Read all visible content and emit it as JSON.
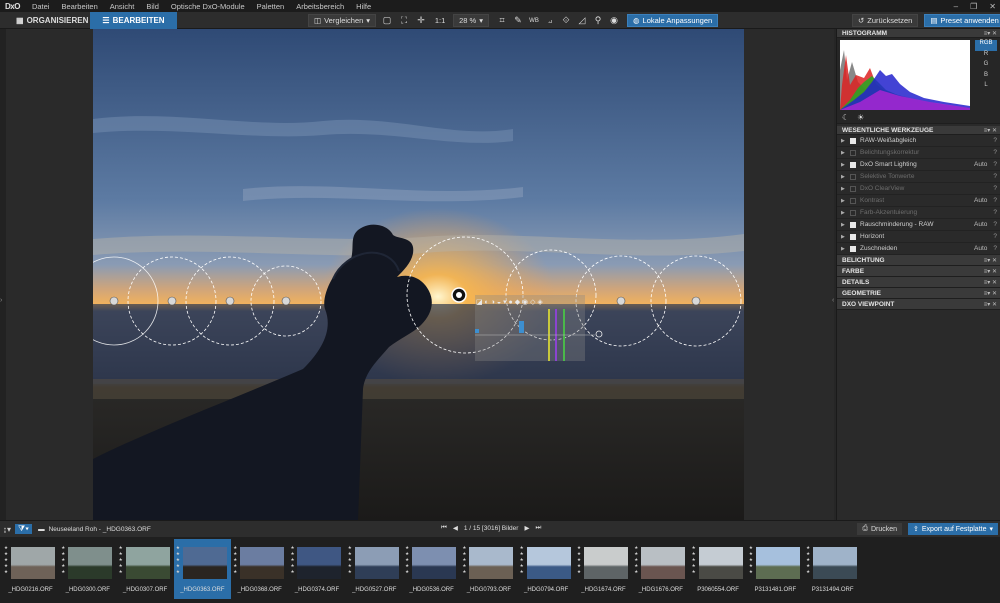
{
  "app": {
    "logo": "DxO"
  },
  "menu": [
    "Datei",
    "Bearbeiten",
    "Ansicht",
    "Bild",
    "Optische DxO-Module",
    "Paletten",
    "Arbeitsbereich",
    "Hilfe"
  ],
  "window_controls": [
    "–",
    "❐",
    "✕"
  ],
  "toolbar": {
    "tab_organize": "ORGANISIEREN",
    "tab_edit": "BEARBEITEN",
    "compare": "Vergleichen",
    "zoom_1to1": "1:1",
    "zoom_value": "28 %",
    "local_adjustments": "Lokale Anpassungen",
    "reset": "Zurücksetzen",
    "apply_preset": "Preset anwenden"
  },
  "histogram": {
    "title": "HISTOGRAMM",
    "channels": [
      "RGB",
      "R",
      "G",
      "B",
      "L"
    ],
    "selected_channel": "RGB"
  },
  "essential_tools": {
    "title": "WESENTLICHE WERKZEUGE",
    "items": [
      {
        "name": "RAW-Weißabgleich",
        "enabled": true,
        "auto": ""
      },
      {
        "name": "Belichtungskorrektur",
        "enabled": false,
        "auto": ""
      },
      {
        "name": "DxO Smart Lighting",
        "enabled": true,
        "auto": "Auto"
      },
      {
        "name": "Selektive Tonwerte",
        "enabled": false,
        "auto": ""
      },
      {
        "name": "DxO ClearView",
        "enabled": false,
        "auto": ""
      },
      {
        "name": "Kontrast",
        "enabled": false,
        "auto": "Auto"
      },
      {
        "name": "Farb-Akzentuierung",
        "enabled": false,
        "auto": ""
      },
      {
        "name": "Rauschminderung - RAW",
        "enabled": true,
        "auto": "Auto"
      },
      {
        "name": "Horizont",
        "enabled": true,
        "auto": ""
      },
      {
        "name": "Zuschneiden",
        "enabled": true,
        "auto": "Auto"
      }
    ]
  },
  "palettes": [
    "BELICHTUNG",
    "FARBE",
    "DETAILS",
    "GEOMETRIE",
    "DXO VIEWPOINT"
  ],
  "statusbar": {
    "folder_path": "Neuseeland Roh - _HDG0363.ORF",
    "counter": "1 / 15 [3016] Bilder",
    "print": "Drucken",
    "export": "Export auf Festplatte"
  },
  "filmstrip": [
    {
      "label": "_HDG0216.ORF",
      "selected": false,
      "sky": "#9fa7a8",
      "ground": "#6e6258"
    },
    {
      "label": "_HDG0300.ORF",
      "selected": false,
      "sky": "#7f8f8c",
      "ground": "#2b3a2a"
    },
    {
      "label": "_HDG0307.ORF",
      "selected": false,
      "sky": "#8fa49f",
      "ground": "#3a4a33"
    },
    {
      "label": "_HDG0363.ORF",
      "selected": true,
      "sky": "#4f6a93",
      "ground": "#2a2520"
    },
    {
      "label": "_HDG0368.ORF",
      "selected": false,
      "sky": "#6b7da1",
      "ground": "#3a3128"
    },
    {
      "label": "_HDG0374.ORF",
      "selected": false,
      "sky": "#3f5783",
      "ground": "#1e232d"
    },
    {
      "label": "_HDG0527.ORF",
      "selected": false,
      "sky": "#8c9db5",
      "ground": "#2f3e57"
    },
    {
      "label": "_HDG0536.ORF",
      "selected": false,
      "sky": "#7d8fb0",
      "ground": "#2a3852"
    },
    {
      "label": "_HDG0793.ORF",
      "selected": false,
      "sky": "#a9b9cc",
      "ground": "#6b6054"
    },
    {
      "label": "_HDG0794.ORF",
      "selected": false,
      "sky": "#b5c7dc",
      "ground": "#3b5a86"
    },
    {
      "label": "_HDG1674.ORF",
      "selected": false,
      "sky": "#c9cccc",
      "ground": "#5e6466"
    },
    {
      "label": "_HDG1676.ORF",
      "selected": false,
      "sky": "#b9bfc4",
      "ground": "#6a5550"
    },
    {
      "label": "P3060554.ORF",
      "selected": false,
      "sky": "#c5ccd3",
      "ground": "#4a4a45"
    },
    {
      "label": "P3131481.ORF",
      "selected": false,
      "sky": "#a6c0dd",
      "ground": "#5d6d52"
    },
    {
      "label": "P3131494.ORF",
      "selected": false,
      "sky": "#9fb3c9",
      "ground": "#3b4a55"
    }
  ]
}
